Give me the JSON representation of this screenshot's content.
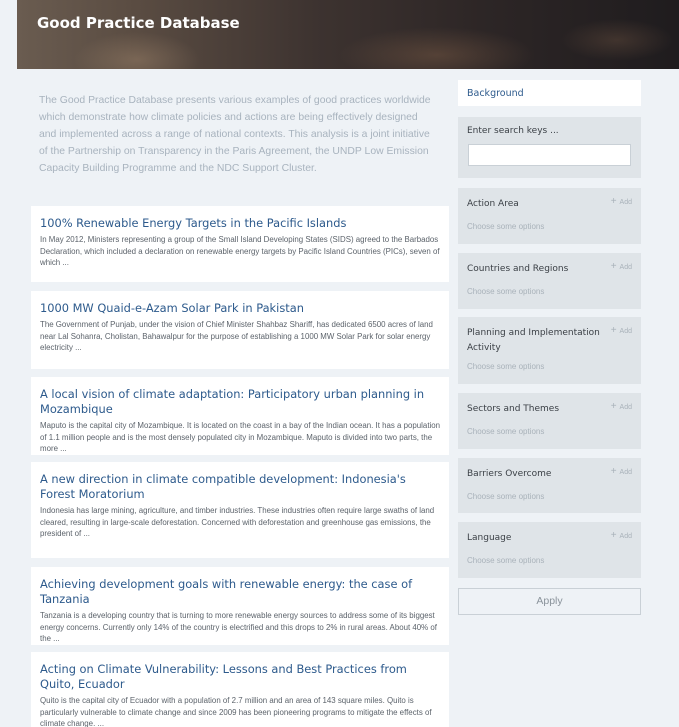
{
  "header": {
    "title": "Good Practice Database"
  },
  "intro": "The Good Practice Database presents various examples of good practices worldwide which demonstrate how climate policies and actions are being effectively designed and implemented across a range of national contexts. This analysis is a joint initiative of the Partnership on Transparency in the Paris Agreement, the UNDP Low Emission Capacity Building Programme and the NDC Support Cluster.",
  "results": [
    {
      "title": "100% Renewable Energy Targets in the Pacific Islands",
      "text": "In May 2012, Ministers representing a group of the Small Island Developing States (SIDS) agreed to the Barbados Declaration, which included a declaration on renewable energy targets by Pacific Island Countries (PICs), seven of which ..."
    },
    {
      "title": "1000 MW Quaid-e-Azam Solar Park in Pakistan",
      "text": "The Government of Punjab, under the vision of Chief Minister Shahbaz Shariff, has dedicated 6500 acres of land near Lal Sohanra, Cholistan, Bahawalpur for the purpose of establishing a 1000 MW Solar Park for solar energy electricity ..."
    },
    {
      "title": "A local vision of climate adaptation: Participatory urban planning in Mozambique",
      "text": "Maputo is the capital city of Mozambique. It is located on the coast in a bay of the Indian ocean. It has a population of 1.1 million people and is the most densely populated city in Mozambique. Maputo is divided into two parts, the more ..."
    },
    {
      "title": "A new direction in climate compatible development: Indonesia's Forest Moratorium",
      "text": "Indonesia has large mining, agriculture, and timber industries. These industries often require large swaths of land cleared, resulting in large-scale deforestation. Concerned with deforestation and greenhouse gas emissions, the president of ..."
    },
    {
      "title": "Achieving development goals with renewable energy: the case of Tanzania",
      "text": "Tanzania is a developing country that is turning to more renewable energy sources to address some of its biggest energy concerns. Currently only 14% of the country is electrified and this drops to 2% in rural areas. About 40% of the ..."
    },
    {
      "title": "Acting on Climate Vulnerability: Lessons and Best Practices from Quito, Ecuador",
      "text": "Quito is the capital city of Ecuador with a population of 2.7 million and an area of 143 square miles. Quito is particularly vulnerable to climate change and since 2009 has been pioneering programs to mitigate the effects of climate change. ..."
    }
  ],
  "sidebar": {
    "background_link": "Background",
    "search_label": "Enter search keys ...",
    "search_value": "",
    "add_label": "Add",
    "choose_placeholder": "Choose some options",
    "filters": [
      {
        "label": "Action Area"
      },
      {
        "label": "Countries and Regions"
      },
      {
        "label": "Planning and Implementation Activity"
      },
      {
        "label": "Sectors and Themes"
      },
      {
        "label": "Barriers Overcome"
      },
      {
        "label": "Language"
      }
    ],
    "apply_label": "Apply"
  }
}
